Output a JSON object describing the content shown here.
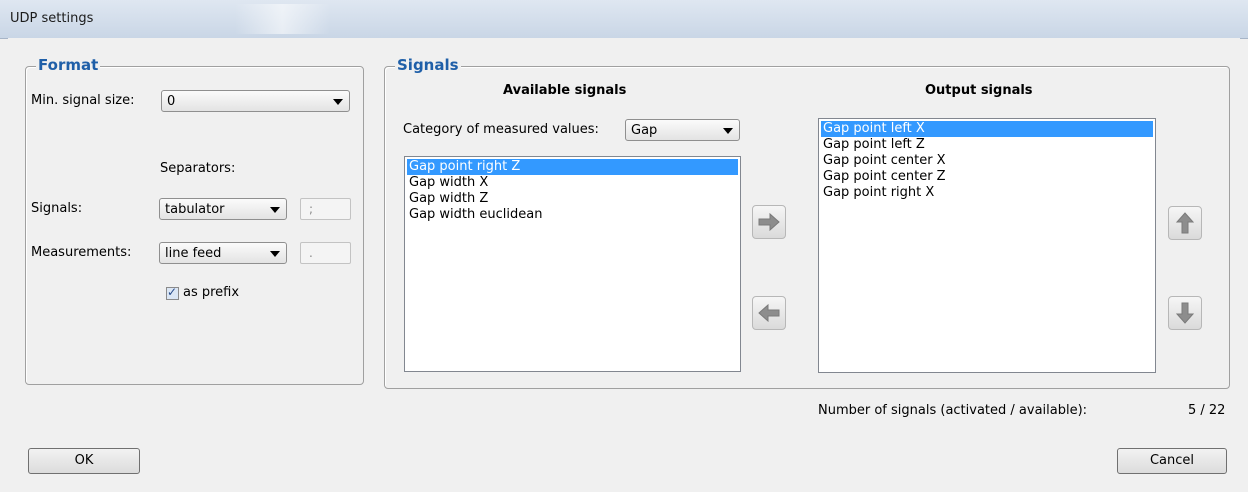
{
  "window": {
    "title": "UDP settings"
  },
  "format": {
    "legend": "Format",
    "min_signal_size_label": "Min. signal size:",
    "min_signal_size_value": "0",
    "separators_label": "Separators:",
    "signals_label": "Signals:",
    "signals_sep_value": "tabulator",
    "signals_sep_char": ";",
    "measurements_label": "Measurements:",
    "measurements_sep_value": "line feed",
    "measurements_sep_char": ".",
    "as_prefix_label": "as prefix",
    "as_prefix_checked": true
  },
  "signals": {
    "legend": "Signals",
    "available_header": "Available signals",
    "output_header": "Output signals",
    "category_label": "Category of measured values:",
    "category_value": "Gap",
    "available_items": [
      "Gap point right Z",
      "Gap width X",
      "Gap width Z",
      "Gap width euclidean"
    ],
    "available_selected_index": 0,
    "output_items": [
      "Gap point left X",
      "Gap point left Z",
      "Gap point center X",
      "Gap point center Z",
      "Gap point right X"
    ],
    "output_selected_index": 0
  },
  "status": {
    "count_label": "Number of signals (activated / available):",
    "count_value": "5 / 22"
  },
  "buttons": {
    "ok": "OK",
    "cancel": "Cancel"
  },
  "colors": {
    "legend": "#1f5fa8",
    "selection": "#3399ff",
    "arrow_icon": "#8d8d8d"
  }
}
